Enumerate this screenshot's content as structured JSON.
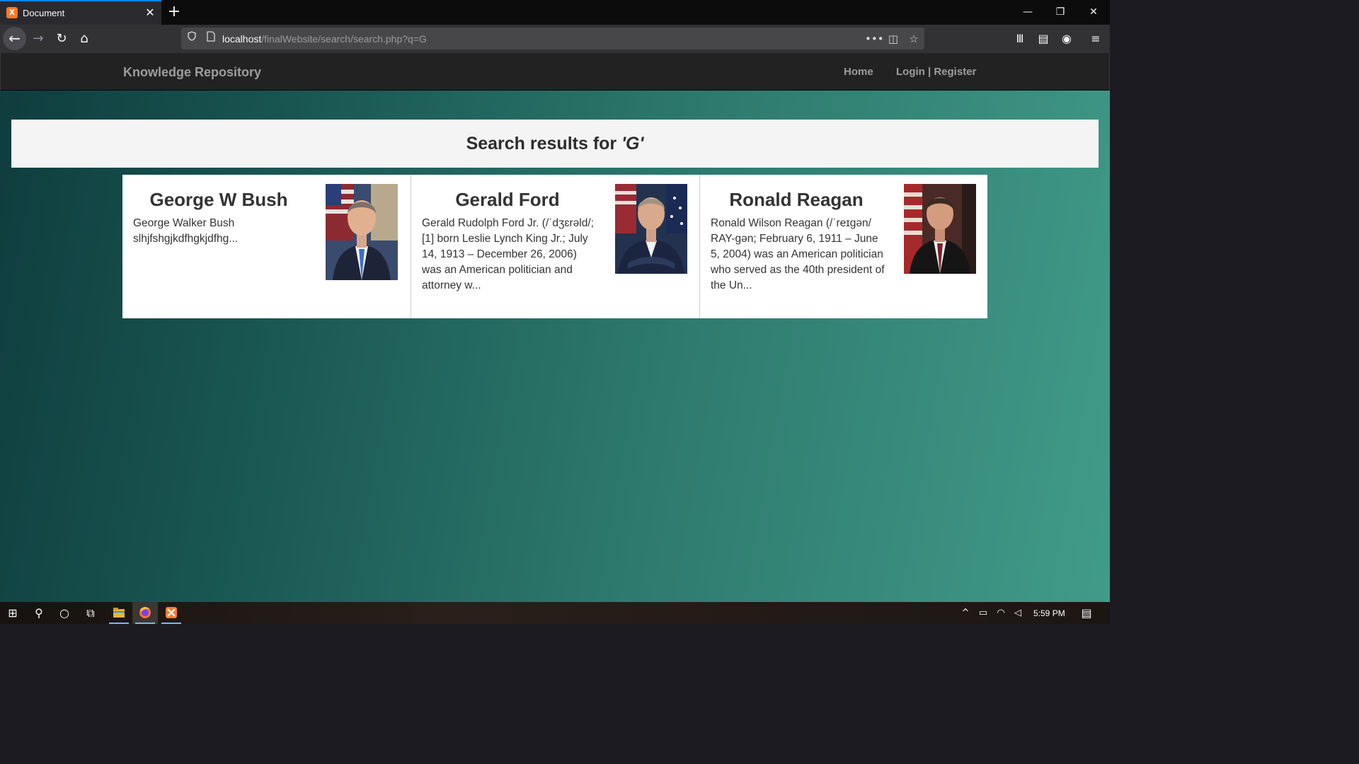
{
  "browser": {
    "tab_title": "Document",
    "tab_close": "✕",
    "new_tab": "+",
    "window_controls": {
      "minimize": "—",
      "restore": "❐",
      "close": "✕"
    },
    "nav": {
      "back": "←",
      "forward": "→",
      "reload": "↻",
      "home": "⌂"
    },
    "url_host": "localhost",
    "url_path": "/finalWebsite/search/search.php?q=G",
    "url_actions": {
      "more": "•••",
      "pocket": "◫",
      "bookmark": "☆"
    },
    "toolbar": {
      "library": "Ⅲ",
      "sidebar": "▤",
      "account": "◉",
      "menu": "≡"
    }
  },
  "site": {
    "brand": "Knowledge Repository",
    "nav_home": "Home",
    "nav_login": "Login | Register"
  },
  "search": {
    "title_prefix": "Search results for ",
    "query": "'G'"
  },
  "results": [
    {
      "name": "George W Bush",
      "description": "George Walker Bush slhjfshgjkdfhgkjdfhg..."
    },
    {
      "name": "Gerald Ford",
      "description": "Gerald Rudolph Ford Jr. (/ˈdʒɛrəld/;[1] born Leslie Lynch King Jr.; July 14, 1913 – December 26, 2006) was an American politician and attorney w..."
    },
    {
      "name": "Ronald Reagan",
      "description": "Ronald Wilson Reagan (/ˈreɪɡən/ RAY-gən; February 6, 1911 – June 5, 2004) was an American politician who served as the 40th president of the Un..."
    }
  ],
  "taskbar": {
    "start": "⊞",
    "search": "⚲",
    "cortana": "○",
    "task_view": "⧉",
    "tray_up": "^",
    "battery": "▭",
    "wifi": "◠",
    "volume": "◁",
    "notifications": "▤",
    "clock": "5:59 PM"
  },
  "colors": {
    "accent": "#0a84ff",
    "navbar": "#222222",
    "nav_text": "#9d9d9d",
    "gradient_start": "#0f3c3e",
    "gradient_end": "#419b89"
  }
}
